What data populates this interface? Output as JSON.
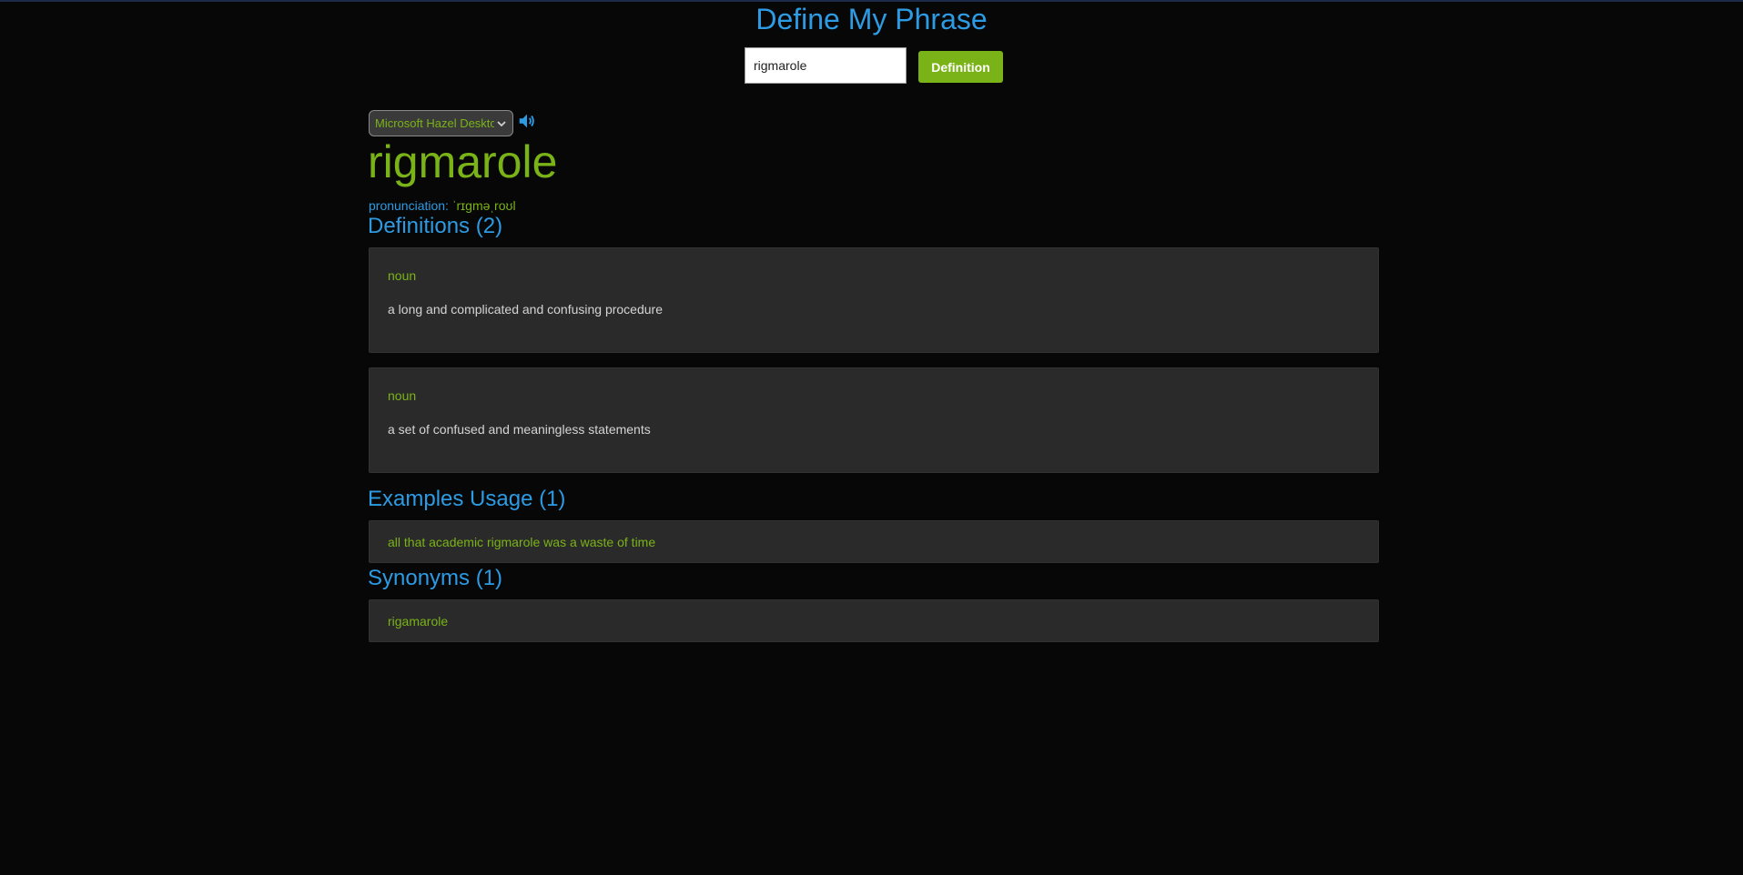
{
  "header": {
    "title": "Define My Phrase"
  },
  "search": {
    "value": "rigmarole",
    "button_label": "Definition"
  },
  "voice": {
    "selected": "Microsoft Hazel Desktop",
    "speaker_icon": "speaker-icon"
  },
  "entry": {
    "word": "rigmarole",
    "pronunciation_label": "pronunciation:",
    "pronunciation_value": "ˈrɪgməˌroʊl"
  },
  "definitions": {
    "heading": "Definitions (2)",
    "items": [
      {
        "pos": "noun",
        "text": "a long and complicated and confusing procedure"
      },
      {
        "pos": "noun",
        "text": "a set of confused and meaningless statements"
      }
    ]
  },
  "examples": {
    "heading": "Examples Usage (1)",
    "items": [
      "all that academic rigmarole was a waste of time"
    ]
  },
  "synonyms": {
    "heading": "Synonyms (1)",
    "items": [
      "rigamarole"
    ]
  },
  "colors": {
    "background": "#070707",
    "accent_blue": "#2d9be3",
    "accent_green": "#7ab317",
    "card": "#2a2a2a"
  }
}
